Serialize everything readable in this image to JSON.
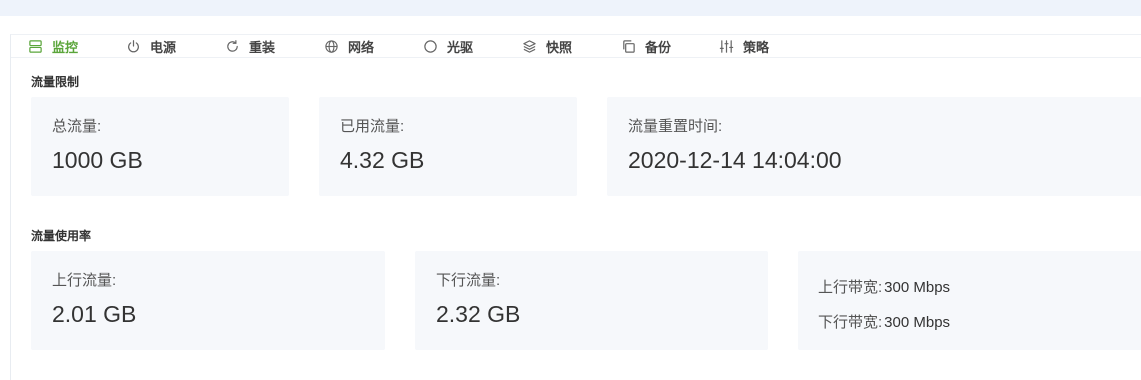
{
  "tabs": [
    {
      "label": "监控",
      "icon": "monitor-icon",
      "active": true
    },
    {
      "label": "电源",
      "icon": "power-icon"
    },
    {
      "label": "重装",
      "icon": "reinstall-icon"
    },
    {
      "label": "网络",
      "icon": "globe-icon"
    },
    {
      "label": "光驱",
      "icon": "disc-icon"
    },
    {
      "label": "快照",
      "icon": "layers-icon"
    },
    {
      "label": "备份",
      "icon": "copy-icon"
    },
    {
      "label": "策略",
      "icon": "sliders-icon"
    }
  ],
  "traffic_limit": {
    "title": "流量限制",
    "total": {
      "label": "总流量:",
      "value": "1000 GB"
    },
    "used": {
      "label": "已用流量:",
      "value": "4.32 GB"
    },
    "reset": {
      "label": "流量重置时间:",
      "value": "2020-12-14 14:04:00"
    }
  },
  "traffic_usage": {
    "title": "流量使用率",
    "upload": {
      "label": "上行流量:",
      "value": "2.01 GB"
    },
    "download": {
      "label": "下行流量:",
      "value": "2.32 GB"
    },
    "bandwidth": {
      "up_label": "上行带宽:",
      "up_value": "300 Mbps",
      "down_label": "下行带宽:",
      "down_value": "300 Mbps"
    }
  },
  "colors": {
    "active_tab": "#5aa53a",
    "card_bg": "#f6f8fb"
  }
}
